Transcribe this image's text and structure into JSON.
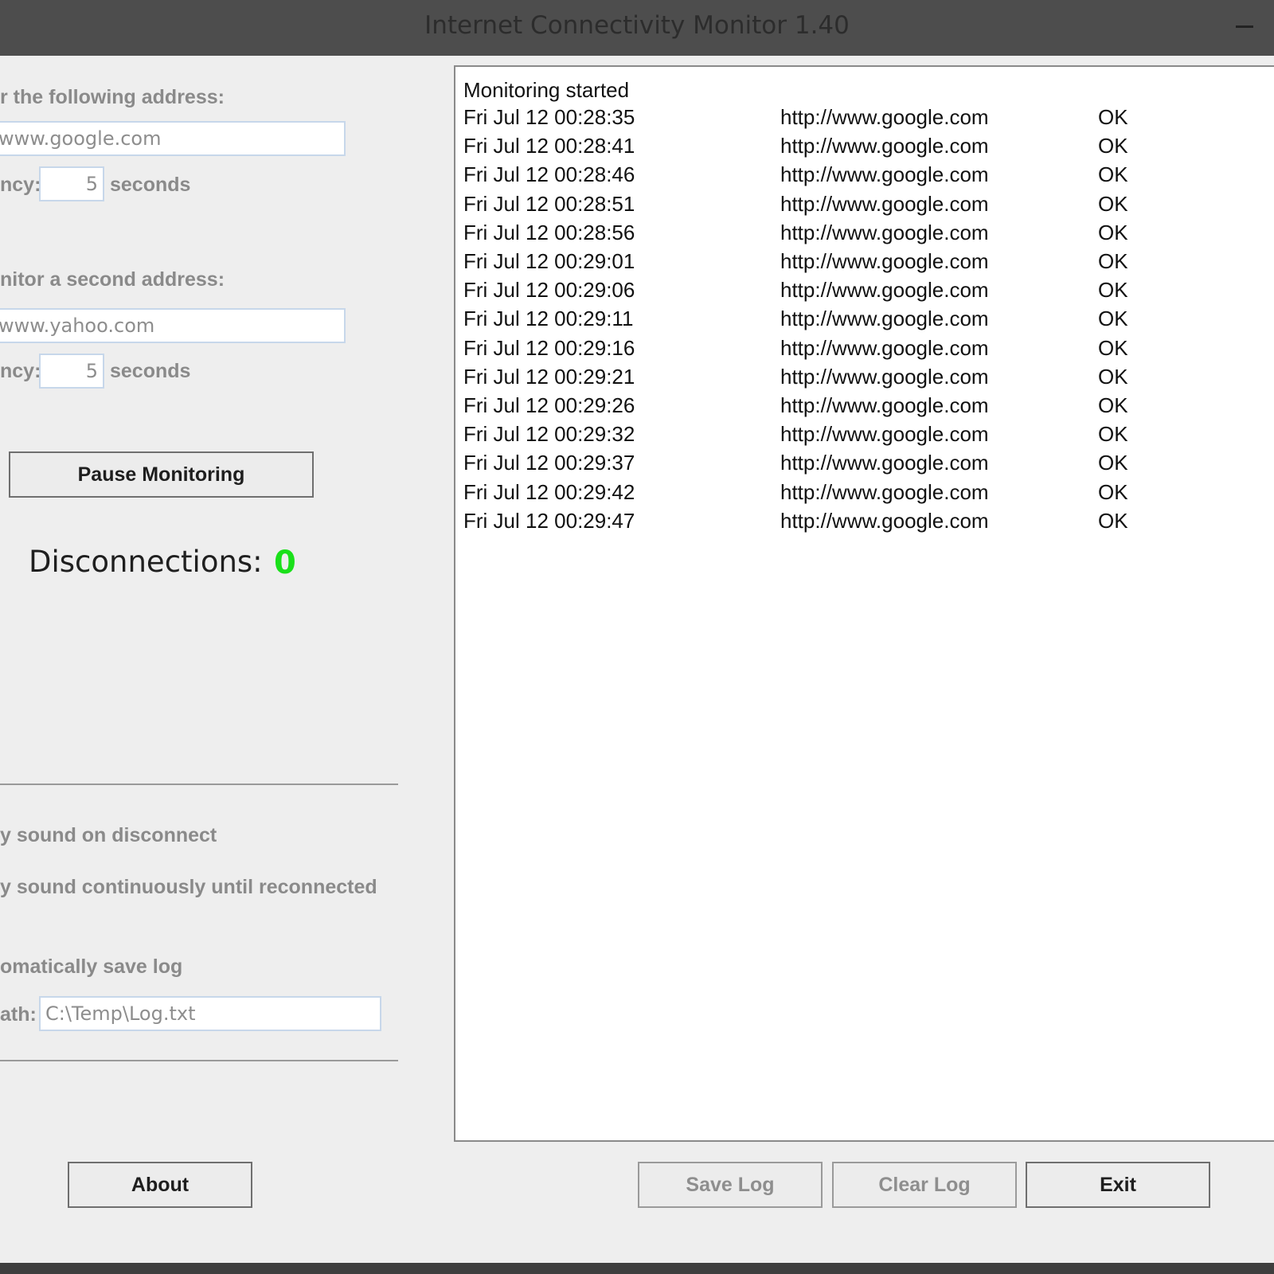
{
  "window": {
    "title": "Internet Connectivity Monitor 1.40"
  },
  "primary": {
    "label": "r the following address:",
    "address": "www.google.com",
    "frequency_label": "ncy:",
    "frequency": "5",
    "unit": "seconds"
  },
  "secondary": {
    "label": "nitor a second address:",
    "address": "www.yahoo.com",
    "frequency_label": "ncy:",
    "frequency": "5",
    "unit": "seconds"
  },
  "controls": {
    "pause_label": "Pause Monitoring"
  },
  "status": {
    "disconnections_label": "Disconnections:",
    "disconnections_count": "0",
    "count_color": "#1ae01a"
  },
  "options": {
    "sound_on_disconnect": "y sound on disconnect",
    "sound_continuous": "y sound continuously until reconnected",
    "auto_save": "omatically save log",
    "path_label": "ath:",
    "path": "C:\\Temp\\Log.txt"
  },
  "log": {
    "header": "Monitoring started",
    "rows": [
      {
        "time": "Fri Jul 12 00:28:35",
        "url": "http://www.google.com",
        "status": "OK"
      },
      {
        "time": "Fri Jul 12 00:28:41",
        "url": "http://www.google.com",
        "status": "OK"
      },
      {
        "time": "Fri Jul 12 00:28:46",
        "url": "http://www.google.com",
        "status": "OK"
      },
      {
        "time": "Fri Jul 12 00:28:51",
        "url": "http://www.google.com",
        "status": "OK"
      },
      {
        "time": "Fri Jul 12 00:28:56",
        "url": "http://www.google.com",
        "status": "OK"
      },
      {
        "time": "Fri Jul 12 00:29:01",
        "url": "http://www.google.com",
        "status": "OK"
      },
      {
        "time": "Fri Jul 12 00:29:06",
        "url": "http://www.google.com",
        "status": "OK"
      },
      {
        "time": "Fri Jul 12 00:29:11",
        "url": "http://www.google.com",
        "status": "OK"
      },
      {
        "time": "Fri Jul 12 00:29:16",
        "url": "http://www.google.com",
        "status": "OK"
      },
      {
        "time": "Fri Jul 12 00:29:21",
        "url": "http://www.google.com",
        "status": "OK"
      },
      {
        "time": "Fri Jul 12 00:29:26",
        "url": "http://www.google.com",
        "status": "OK"
      },
      {
        "time": "Fri Jul 12 00:29:32",
        "url": "http://www.google.com",
        "status": "OK"
      },
      {
        "time": "Fri Jul 12 00:29:37",
        "url": "http://www.google.com",
        "status": "OK"
      },
      {
        "time": "Fri Jul 12 00:29:42",
        "url": "http://www.google.com",
        "status": "OK"
      },
      {
        "time": "Fri Jul 12 00:29:47",
        "url": "http://www.google.com",
        "status": "OK"
      }
    ]
  },
  "buttons": {
    "about": "About",
    "save_log": "Save Log",
    "clear_log": "Clear Log",
    "exit": "Exit"
  }
}
